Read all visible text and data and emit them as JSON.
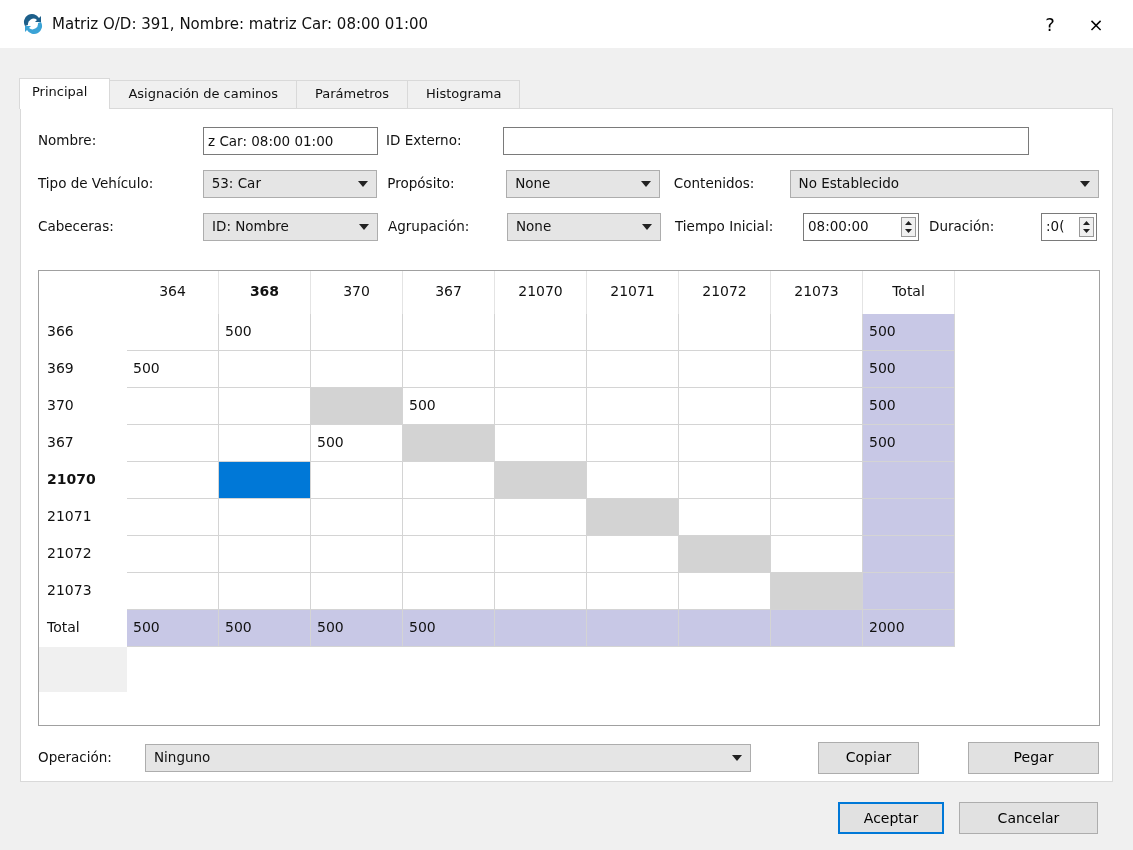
{
  "window": {
    "title": "Matriz O/D: 391, Nombre: matriz Car: 08:00 01:00",
    "help": "?",
    "close": "×"
  },
  "tabs": [
    {
      "label": "Principal",
      "selected": true
    },
    {
      "label": "Asignación de caminos",
      "selected": false
    },
    {
      "label": "Parámetros",
      "selected": false
    },
    {
      "label": "Histograma",
      "selected": false
    }
  ],
  "form": {
    "nombre": {
      "label": "Nombre:",
      "value": "z Car: 08:00 01:00"
    },
    "id_externo": {
      "label": "ID Externo:"
    },
    "tipo_vehiculo": {
      "label": "Tipo de Vehículo:",
      "value": "53: Car"
    },
    "proposito": {
      "label": "Propósito:",
      "value": "None"
    },
    "contenidos": {
      "label": "Contenidos:",
      "value": "No Establecido"
    },
    "cabeceras": {
      "label": "Cabeceras:",
      "value": "ID: Nombre"
    },
    "agrupacion": {
      "label": "Agrupación:",
      "value": "None"
    },
    "tiempo_inicial": {
      "label": "Tiempo Inicial:",
      "value": "08:00:00"
    },
    "duracion": {
      "label": "Duración:",
      "value": ":0("
    }
  },
  "matrix": {
    "columns": [
      {
        "label": "364",
        "current": false
      },
      {
        "label": "368",
        "current": true
      },
      {
        "label": "370",
        "current": false
      },
      {
        "label": "367",
        "current": false
      },
      {
        "label": "21070",
        "current": false
      },
      {
        "label": "21071",
        "current": false
      },
      {
        "label": "21072",
        "current": false
      },
      {
        "label": "21073",
        "current": false
      },
      {
        "label": "Total",
        "current": false
      }
    ],
    "rows": [
      {
        "label": "366",
        "current": false,
        "cells": [
          {
            "kind": "empty"
          },
          {
            "kind": "value",
            "value": "500"
          },
          {
            "kind": "empty"
          },
          {
            "kind": "empty"
          },
          {
            "kind": "empty"
          },
          {
            "kind": "empty"
          },
          {
            "kind": "empty"
          },
          {
            "kind": "empty"
          },
          {
            "kind": "total",
            "value": "500"
          }
        ]
      },
      {
        "label": "369",
        "current": false,
        "cells": [
          {
            "kind": "value",
            "value": "500"
          },
          {
            "kind": "empty"
          },
          {
            "kind": "empty"
          },
          {
            "kind": "empty"
          },
          {
            "kind": "empty"
          },
          {
            "kind": "empty"
          },
          {
            "kind": "empty"
          },
          {
            "kind": "empty"
          },
          {
            "kind": "total",
            "value": "500"
          }
        ]
      },
      {
        "label": "370",
        "current": false,
        "cells": [
          {
            "kind": "empty"
          },
          {
            "kind": "empty"
          },
          {
            "kind": "diagonal"
          },
          {
            "kind": "value",
            "value": "500"
          },
          {
            "kind": "empty"
          },
          {
            "kind": "empty"
          },
          {
            "kind": "empty"
          },
          {
            "kind": "empty"
          },
          {
            "kind": "total",
            "value": "500"
          }
        ]
      },
      {
        "label": "367",
        "current": false,
        "cells": [
          {
            "kind": "empty"
          },
          {
            "kind": "empty"
          },
          {
            "kind": "value",
            "value": "500"
          },
          {
            "kind": "diagonal"
          },
          {
            "kind": "empty"
          },
          {
            "kind": "empty"
          },
          {
            "kind": "empty"
          },
          {
            "kind": "empty"
          },
          {
            "kind": "total",
            "value": "500"
          }
        ]
      },
      {
        "label": "21070",
        "current": true,
        "cells": [
          {
            "kind": "empty"
          },
          {
            "kind": "selected"
          },
          {
            "kind": "empty"
          },
          {
            "kind": "empty"
          },
          {
            "kind": "diagonal"
          },
          {
            "kind": "empty"
          },
          {
            "kind": "empty"
          },
          {
            "kind": "empty"
          },
          {
            "kind": "total"
          }
        ]
      },
      {
        "label": "21071",
        "current": false,
        "cells": [
          {
            "kind": "empty"
          },
          {
            "kind": "empty"
          },
          {
            "kind": "empty"
          },
          {
            "kind": "empty"
          },
          {
            "kind": "empty"
          },
          {
            "kind": "diagonal"
          },
          {
            "kind": "empty"
          },
          {
            "kind": "empty"
          },
          {
            "kind": "total"
          }
        ]
      },
      {
        "label": "21072",
        "current": false,
        "cells": [
          {
            "kind": "empty"
          },
          {
            "kind": "empty"
          },
          {
            "kind": "empty"
          },
          {
            "kind": "empty"
          },
          {
            "kind": "empty"
          },
          {
            "kind": "empty"
          },
          {
            "kind": "diagonal"
          },
          {
            "kind": "empty"
          },
          {
            "kind": "total"
          }
        ]
      },
      {
        "label": "21073",
        "current": false,
        "cells": [
          {
            "kind": "empty"
          },
          {
            "kind": "empty"
          },
          {
            "kind": "empty"
          },
          {
            "kind": "empty"
          },
          {
            "kind": "empty"
          },
          {
            "kind": "empty"
          },
          {
            "kind": "empty"
          },
          {
            "kind": "diagonal"
          },
          {
            "kind": "total"
          }
        ]
      },
      {
        "label": "Total",
        "current": false,
        "cells": [
          {
            "kind": "total",
            "value": "500"
          },
          {
            "kind": "total",
            "value": "500"
          },
          {
            "kind": "total",
            "value": "500"
          },
          {
            "kind": "total",
            "value": "500"
          },
          {
            "kind": "total"
          },
          {
            "kind": "total"
          },
          {
            "kind": "total"
          },
          {
            "kind": "total"
          },
          {
            "kind": "total",
            "value": "2000"
          }
        ]
      }
    ]
  },
  "operation": {
    "label": "Operación:",
    "value": "Ninguno"
  },
  "operation_buttons": [
    {
      "label": "Copiar",
      "focused": false
    },
    {
      "label": "Pegar",
      "focused": false
    }
  ],
  "dialog_buttons": [
    {
      "label": "Aceptar",
      "focused": true
    },
    {
      "label": "Cancelar",
      "focused": false
    }
  ]
}
